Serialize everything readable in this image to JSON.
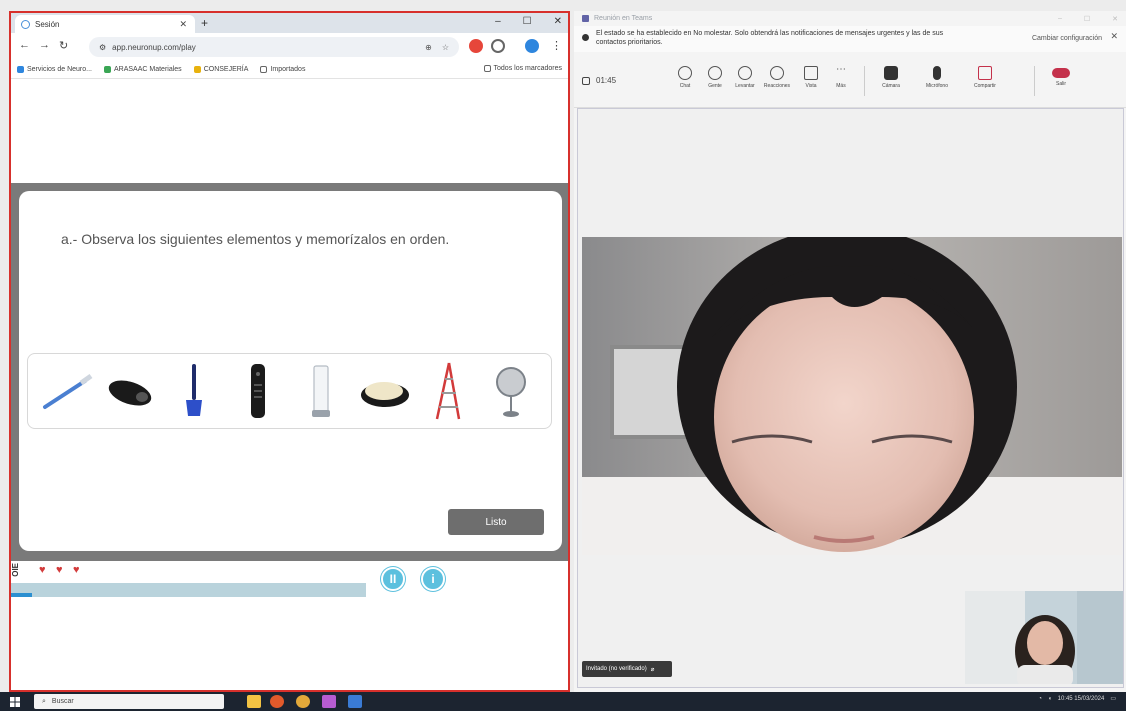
{
  "browser": {
    "tab_title": "Sesión",
    "address": "app.neuronup.com/play",
    "bookmarks": [
      "Servicios de Neuro...",
      "ARASAAC Materiales",
      "CONSEJERÍA",
      "Importados"
    ],
    "all_bookmarks": "Todos los marcadores",
    "colors": {
      "frame": "#d7302c",
      "chrome": "#dde3ea"
    }
  },
  "game": {
    "instruction": "a.- Observa los siguientes elementos y memorízalos en orden.",
    "items": [
      {
        "name": "toothbrush"
      },
      {
        "name": "hair-clipper"
      },
      {
        "name": "dustpan-brush"
      },
      {
        "name": "tv-remote"
      },
      {
        "name": "glass"
      },
      {
        "name": "soap"
      },
      {
        "name": "ladder"
      },
      {
        "name": "mirror"
      }
    ],
    "done_button": "Listo",
    "lives": 3,
    "progress_fraction": 0.06,
    "pause_glyph": "II",
    "info_glyph": "i",
    "hud_label": "OIE",
    "colors": {
      "accent": "#5cc0de",
      "heart": "#d33b3b",
      "progress_track": "#b9d3dc",
      "progress_fill": "#2b8fd0",
      "backdrop": "#7a7a7a"
    }
  },
  "call": {
    "window_title": "Reunión en Teams",
    "notice": "El estado se ha establecido en No molestar. Solo obtendrá las notificaciones de mensajes urgentes y las de sus contactos prioritarios.",
    "notice_action": "Cambiar configuración",
    "timer": "01:45",
    "toolbar": [
      {
        "label": "Chat",
        "icon": "chat-icon"
      },
      {
        "label": "Gente",
        "icon": "people-icon"
      },
      {
        "label": "Levantar",
        "icon": "raise-hand-icon"
      },
      {
        "label": "Reacciones",
        "icon": "reactions-icon"
      },
      {
        "label": "Vista",
        "icon": "view-icon"
      },
      {
        "label": "Más",
        "icon": "more-icon"
      },
      {
        "label": "Cámara",
        "icon": "camera-icon"
      },
      {
        "label": "Micrófono",
        "icon": "mic-icon"
      },
      {
        "label": "Compartir",
        "icon": "share-icon"
      },
      {
        "label": "Salir",
        "icon": "leave-icon"
      }
    ],
    "participant_name": "Invitado (no verificado)",
    "colors": {
      "leave": "#c4314b"
    }
  },
  "taskbar": {
    "search_placeholder": "Buscar",
    "clock": "10:45",
    "date": "15/03/2024"
  }
}
